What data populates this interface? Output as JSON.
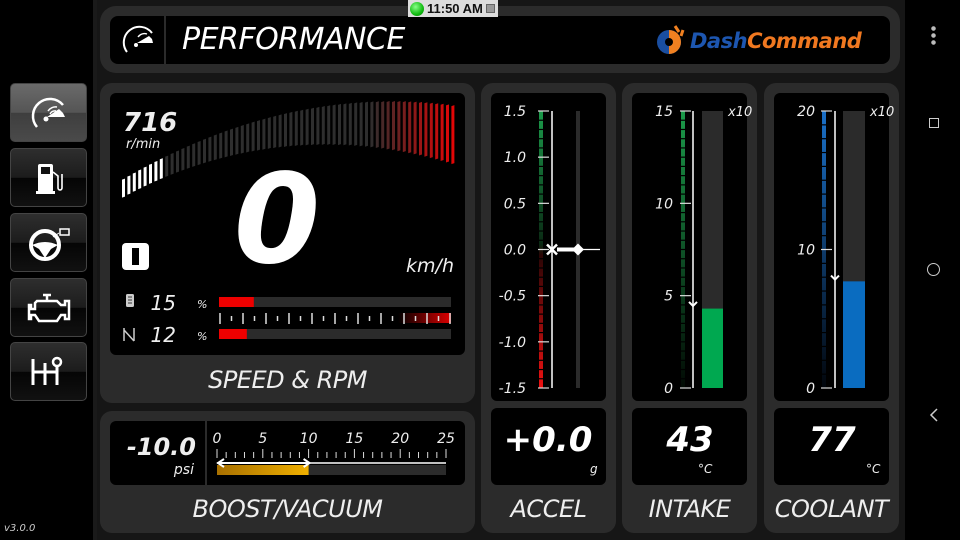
{
  "status": {
    "time": "11:50 AM",
    "indicator_color": "#22cc22"
  },
  "header": {
    "title": "PERFORMANCE",
    "logo": {
      "text_part1": "Dash",
      "text_part2": "Command"
    }
  },
  "version": "v3.0.0",
  "sidebar": {
    "items": [
      {
        "icon": "gauge-icon",
        "active": true
      },
      {
        "icon": "fuel-pump-icon",
        "active": false
      },
      {
        "icon": "steering-wheel-icon",
        "active": false
      },
      {
        "icon": "engine-icon",
        "active": false
      },
      {
        "icon": "gear-shifter-icon",
        "active": false
      }
    ]
  },
  "speed_rpm": {
    "label": "SPEED & RPM",
    "rpm": "716",
    "rpm_unit": "r/min",
    "speed": "0",
    "speed_unit": "km/h",
    "gear": "I",
    "throttle": {
      "value": "15",
      "unit": "%",
      "fraction": 0.15
    },
    "load": {
      "value": "12",
      "unit": "%",
      "fraction": 0.12
    },
    "rpm_fraction": 0.12
  },
  "boost": {
    "label": "BOOST/VACUUM",
    "value": "-10.0",
    "unit": "psi",
    "scale": [
      "0",
      "5",
      "10",
      "15",
      "20",
      "25"
    ],
    "bar_value": 10,
    "max": 25,
    "color": "#e8a800"
  },
  "accel": {
    "label": "ACCEL",
    "value": "+0.0",
    "unit": "g",
    "scale": [
      "1.5",
      "1.0",
      "0.5",
      "0.0",
      "-0.5",
      "-1.0",
      "-1.5"
    ],
    "current": 0.0
  },
  "intake": {
    "label": "INTAKE",
    "value": "43",
    "unit": "°C",
    "multiplier": "x10",
    "scale": [
      "15",
      "10",
      "5",
      "0"
    ],
    "max": 15,
    "bar_value": 4.3,
    "marker": 4.5,
    "color": "#00a850"
  },
  "coolant": {
    "label": "COOLANT",
    "value": "77",
    "unit": "°C",
    "multiplier": "x10",
    "scale": [
      "20",
      "10",
      "0"
    ],
    "max": 20,
    "bar_value": 7.7,
    "marker": 7.9,
    "color": "#0a6cc0"
  },
  "nav": {
    "menu": "more-vert-icon",
    "recents": "recents-icon",
    "home": "home-icon",
    "back": "back-icon"
  }
}
